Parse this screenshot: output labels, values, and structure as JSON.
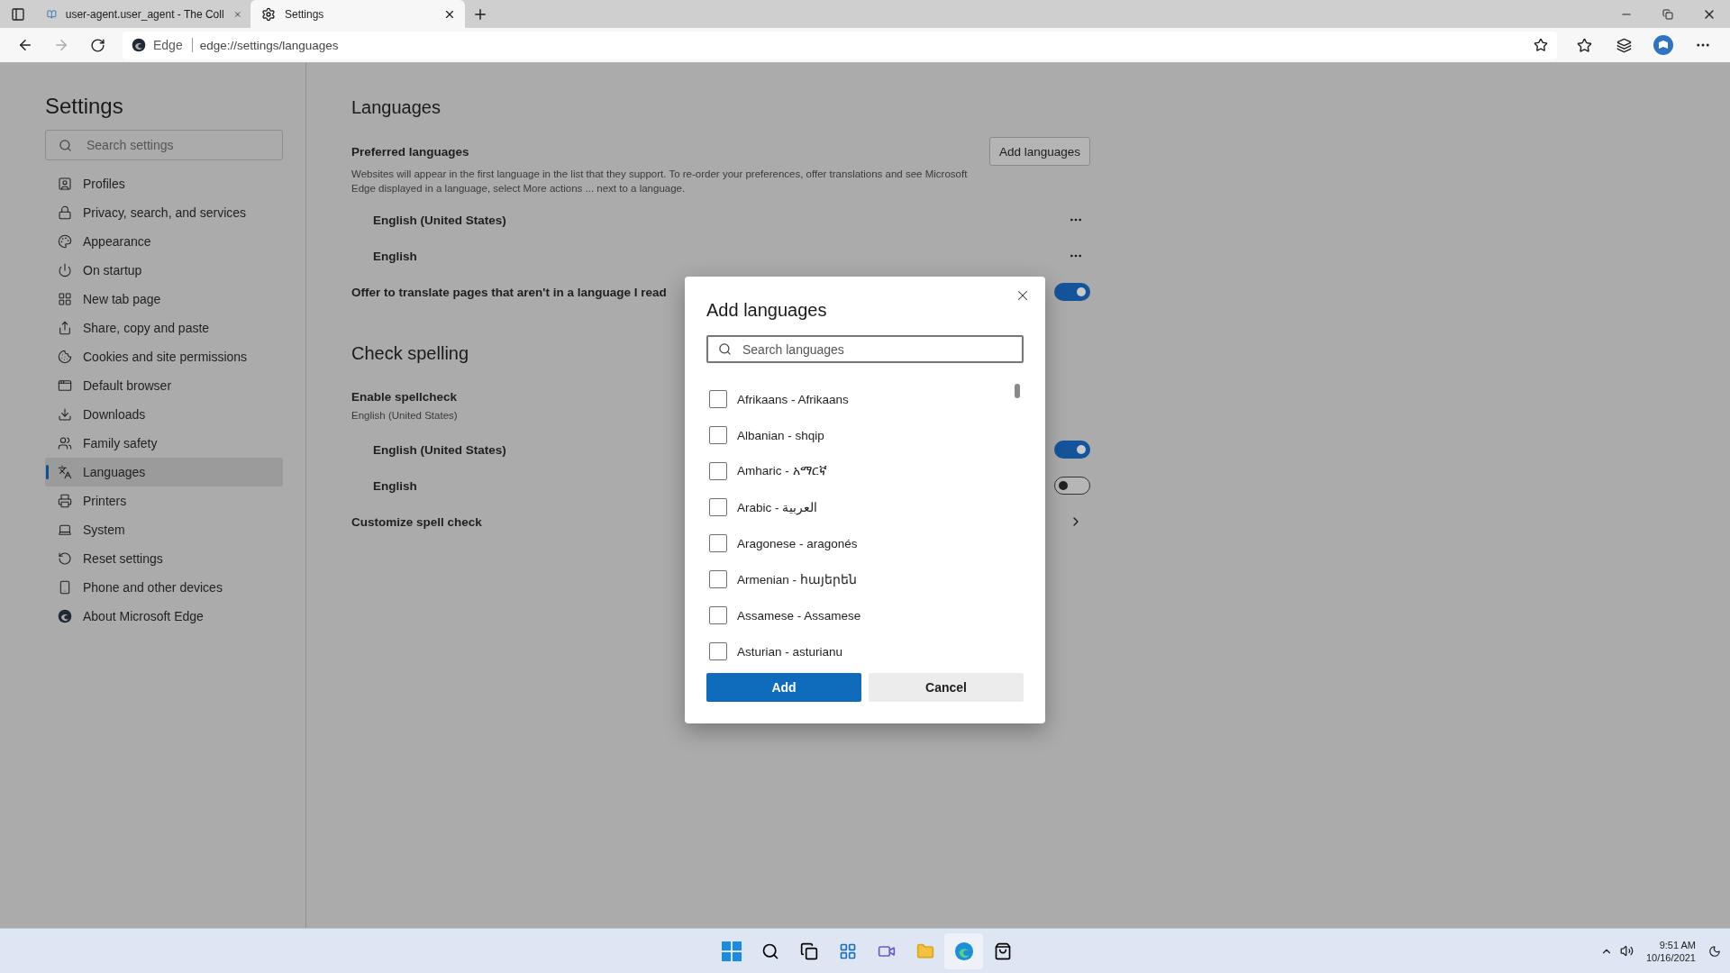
{
  "browser": {
    "tabs": [
      {
        "title": "user-agent.user_agent - The Coll",
        "selected": false
      },
      {
        "title": "Settings",
        "selected": true
      }
    ],
    "address": {
      "site": "Edge",
      "url": "edge://settings/languages"
    }
  },
  "sidebar": {
    "title": "Settings",
    "search": {
      "placeholder": "Search settings"
    },
    "items": [
      {
        "label": "Profiles",
        "selected": false
      },
      {
        "label": "Privacy, search, and services",
        "selected": false
      },
      {
        "label": "Appearance",
        "selected": false
      },
      {
        "label": "On startup",
        "selected": false
      },
      {
        "label": "New tab page",
        "selected": false
      },
      {
        "label": "Share, copy and paste",
        "selected": false
      },
      {
        "label": "Cookies and site permissions",
        "selected": false
      },
      {
        "label": "Default browser",
        "selected": false
      },
      {
        "label": "Downloads",
        "selected": false
      },
      {
        "label": "Family safety",
        "selected": false
      },
      {
        "label": "Languages",
        "selected": true
      },
      {
        "label": "Printers",
        "selected": false
      },
      {
        "label": "System",
        "selected": false
      },
      {
        "label": "Reset settings",
        "selected": false
      },
      {
        "label": "Phone and other devices",
        "selected": false
      },
      {
        "label": "About Microsoft Edge",
        "selected": false
      }
    ]
  },
  "main": {
    "title": "Languages",
    "preferred": {
      "label": "Preferred languages",
      "description": "Websites will appear in the first language in the list that they support. To re-order your preferences, offer translations and see Microsoft Edge displayed in a language, select More actions ... next to a language.",
      "button": "Add languages",
      "languages": [
        "English (United States)",
        "English"
      ]
    },
    "translate": {
      "label": "Offer to translate pages that aren't in a language I read",
      "on": true
    },
    "spelling": {
      "title": "Check spelling",
      "label": "Enable spellcheck",
      "sublabel": "English (United States)",
      "languages": [
        {
          "name": "English (United States)",
          "on": true
        },
        {
          "name": "English",
          "on": false
        }
      ],
      "customize": "Customize spell check"
    }
  },
  "dialog": {
    "title": "Add languages",
    "search": {
      "placeholder": "Search languages"
    },
    "languages": [
      {
        "name": "Afrikaans - Afrikaans",
        "checked": false
      },
      {
        "name": "Albanian - shqip",
        "checked": false
      },
      {
        "name": "Amharic - አማርኛ",
        "checked": false
      },
      {
        "name": "Arabic - العربية",
        "checked": false
      },
      {
        "name": "Aragonese - aragonés",
        "checked": false
      },
      {
        "name": "Armenian - հայերեն",
        "checked": false
      },
      {
        "name": "Assamese - Assamese",
        "checked": false
      },
      {
        "name": "Asturian - asturianu",
        "checked": false
      }
    ],
    "add": "Add",
    "cancel": "Cancel"
  },
  "taskbar": {
    "time": "9:51 AM",
    "date": "10/16/2021"
  }
}
